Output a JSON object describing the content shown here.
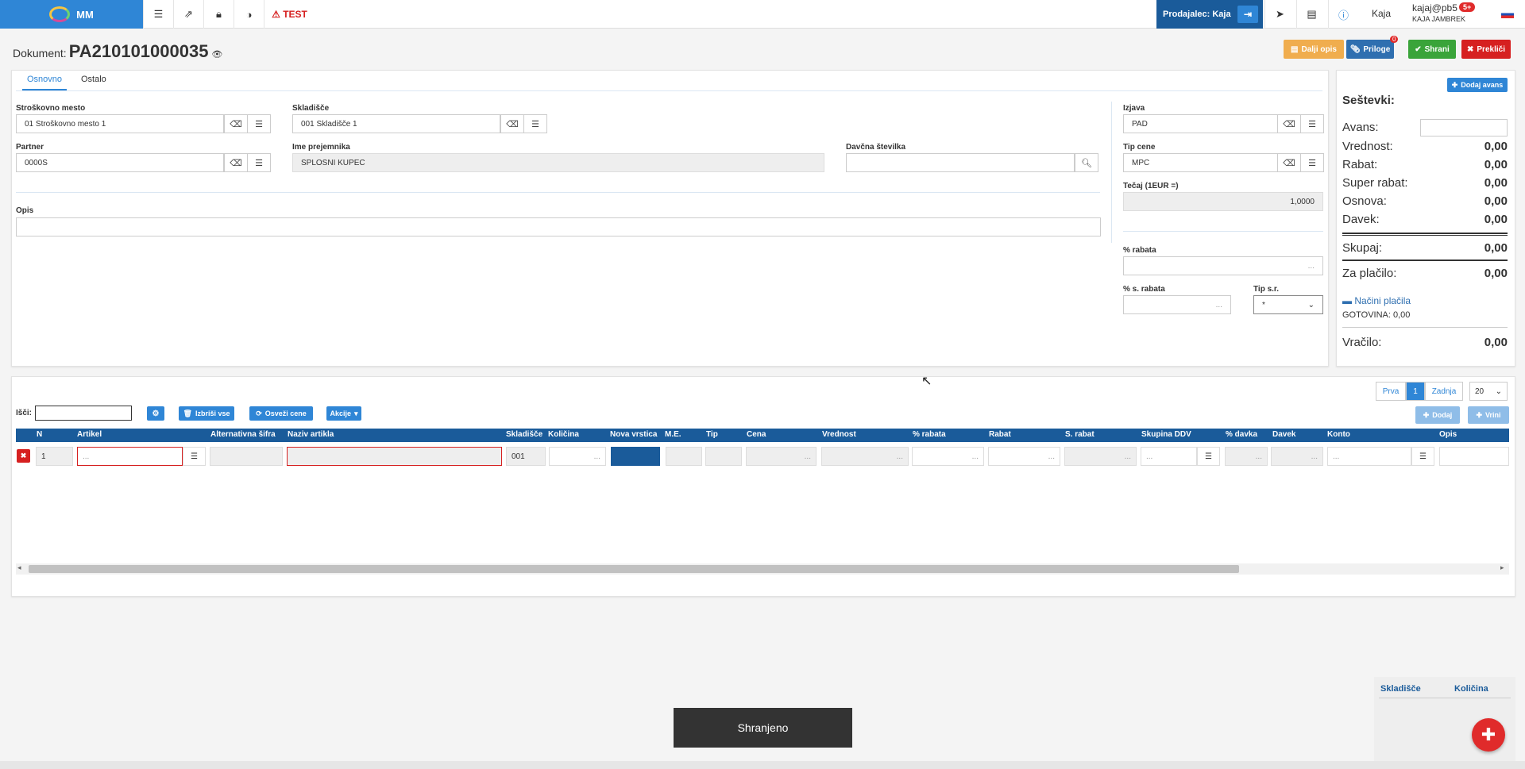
{
  "app": {
    "logo_text": "MM",
    "test_label": "TEST",
    "brand_color": "#2f86d6"
  },
  "topbar": {
    "seller": "Prodajalec: Kaja",
    "username": "Kaja",
    "user_email": "kajaj@pb5",
    "user_fullname": "KAJA JAMBREK",
    "badge": "5+"
  },
  "document": {
    "label": "Dokument:",
    "number": "PA210101000035"
  },
  "actions": {
    "more_desc": "Dalji opis",
    "attachments": "Priloge",
    "attachments_count": "0",
    "save": "Shrani",
    "cancel": "Prekliči"
  },
  "tabs": [
    "Osnovno",
    "Ostalo"
  ],
  "form": {
    "cost_center_label": "Stroškovno mesto",
    "cost_center_value": "01 Stroškovno mesto 1",
    "warehouse_label": "Skladišče",
    "warehouse_value": "001 Skladišče 1",
    "partner_label": "Partner",
    "partner_value": "0000S",
    "recipient_label": "Ime prejemnika",
    "recipient_value": "SPLOSNI KUPEC",
    "tax_label": "Davčna številka",
    "tax_value": "",
    "desc_label": "Opis",
    "desc_value": "",
    "statement_label": "Izjava",
    "statement_value": "PAD",
    "price_type_label": "Tip cene",
    "price_type_value": "MPC",
    "rate_label": "Tečaj (1EUR =)",
    "rate_value": "1,0000",
    "discount_label": "% rabata",
    "discount_value": "...",
    "sdiscount_label": "% s. rabata",
    "sdiscount_value": "...",
    "sr_type_label": "Tip s.r.",
    "sr_type_value": "*"
  },
  "summary": {
    "add_advance": "Dodaj avans",
    "title": "Seštevki:",
    "advance_label": "Avans:",
    "rows": [
      {
        "label": "Vrednost:",
        "value": "0,00"
      },
      {
        "label": "Rabat:",
        "value": "0,00"
      },
      {
        "label": "Super rabat:",
        "value": "0,00"
      },
      {
        "label": "Osnova:",
        "value": "0,00"
      },
      {
        "label": "Davek:",
        "value": "0,00"
      }
    ],
    "total_label": "Skupaj:",
    "total_value": "0,00",
    "pay_label": "Za plačilo:",
    "pay_value": "0,00",
    "payment_methods": "Načini plačila",
    "cash": "GOTOVINA: 0,00",
    "change_label": "Vračilo:",
    "change_value": "0,00"
  },
  "grid": {
    "search_label": "Išči:",
    "delete_all": "Izbriši vse",
    "refresh_prices": "Osveži cene",
    "actions": "Akcije",
    "add": "Dodaj",
    "insert": "Vrini",
    "pager": {
      "first": "Prva",
      "page": "1",
      "last": "Zadnja",
      "per_page": "20"
    },
    "columns": [
      "N",
      "Artikel",
      "Alternativna šifra",
      "Naziv artikla",
      "Skladišče",
      "Količina",
      "Nova vrstica",
      "M.E.",
      "Tip",
      "Cena",
      "Vrednost",
      "% rabata",
      "Rabat",
      "S. rabat",
      "Skupina DDV",
      "% davka",
      "Davek",
      "Konto",
      "Opis"
    ],
    "row": {
      "n": "1",
      "article": "...",
      "warehouse": "001",
      "dots": "..."
    }
  },
  "side_table": {
    "col1": "Skladišče",
    "col2": "Količina"
  },
  "toast": "Shranjeno"
}
